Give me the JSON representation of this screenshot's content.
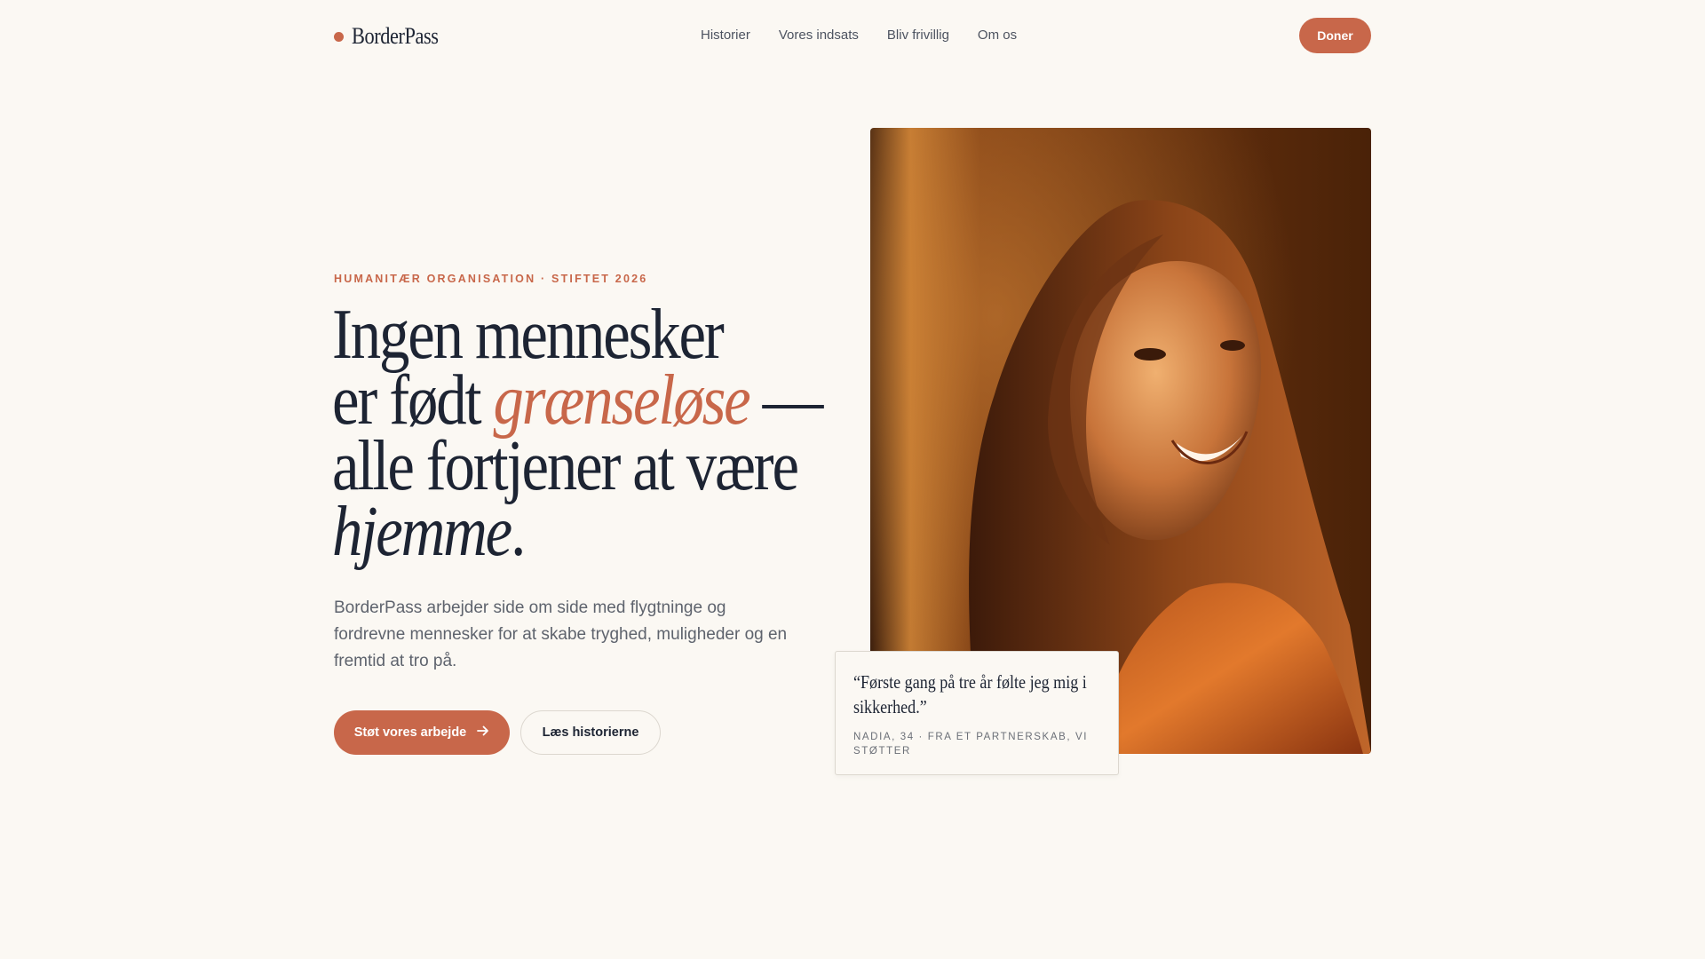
{
  "brand": {
    "name": "BorderPass",
    "accent": "#c8674a",
    "ink": "#1d2433",
    "background": "#fbf8f3"
  },
  "nav": {
    "links": [
      "Historier",
      "Vores indsats",
      "Bliv frivillig",
      "Om os"
    ],
    "donate_label": "Doner"
  },
  "hero": {
    "eyebrow": "HUMANITÆR ORGANISATION · STIFTET 2026",
    "headline": {
      "line1": "Ingen mennesker",
      "line2_start": "er født ",
      "line2_accent": "grænseløse",
      "line2_end": " —",
      "line3": "alle fortjener at være",
      "line4_italic": "hjemme",
      "line4_end": "."
    },
    "lede": "BorderPass arbejder side om side med flygtninge og fordrevne mennesker for at skabe tryghed, muligheder og en fremtid at tro på.",
    "primary_cta": "Støt vores arbejde",
    "primary_cta_icon": "arrow-right-icon",
    "secondary_cta": "Læs historierne"
  },
  "quote": {
    "text": "“Første gang på tre år følte jeg mig i sikkerhed.”",
    "attribution": "NADIA, 34 · FRA ET PARTNERSKAB, VI STØTTER"
  }
}
